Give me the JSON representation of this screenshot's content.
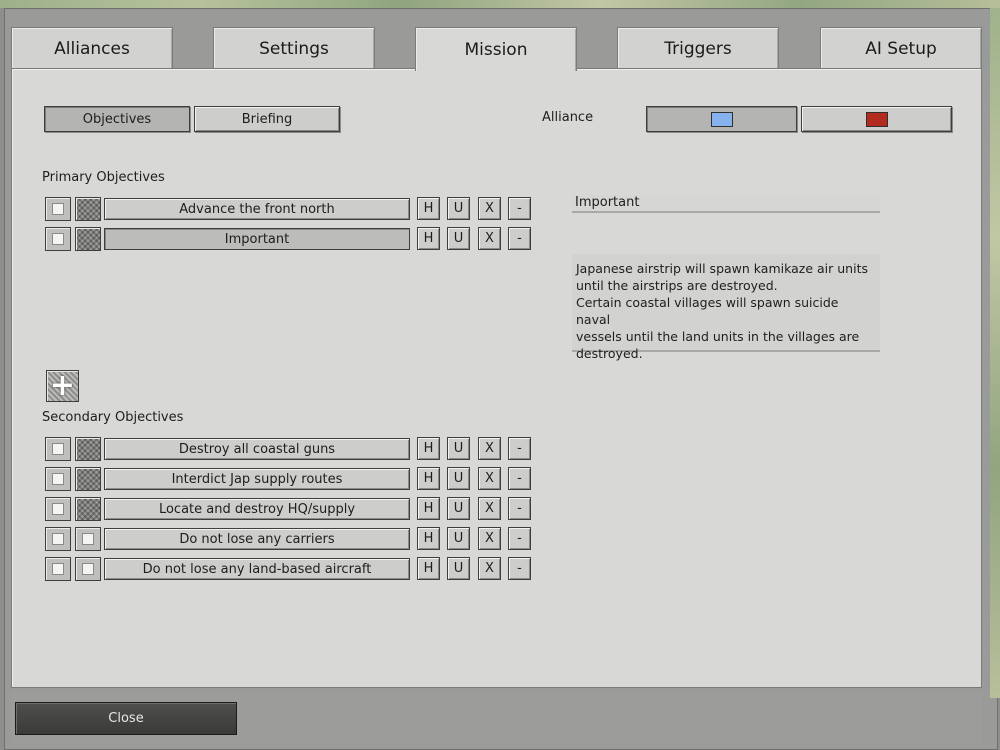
{
  "tabs": [
    {
      "label": "Alliances"
    },
    {
      "label": "Settings"
    },
    {
      "label": "Mission"
    },
    {
      "label": "Triggers"
    },
    {
      "label": "AI Setup"
    }
  ],
  "subtabs": {
    "objectives": "Objectives",
    "briefing": "Briefing"
  },
  "alliance": {
    "label": "Alliance",
    "colors": [
      "#86b2ee",
      "#b32a1e"
    ]
  },
  "primary": {
    "heading": "Primary Objectives",
    "items": [
      {
        "label": "Advance the front north"
      },
      {
        "label": "Important"
      }
    ]
  },
  "secondary": {
    "heading": "Secondary Objectives",
    "items": [
      {
        "label": "Destroy all coastal guns"
      },
      {
        "label": "Interdict Jap supply routes"
      },
      {
        "label": "Locate and destroy HQ/supply"
      },
      {
        "label": "Do not lose any carriers"
      },
      {
        "label": "Do not lose any land-based aircraft"
      }
    ]
  },
  "row_buttons": {
    "h": "H",
    "u": "U",
    "x": "X",
    "minus": "-"
  },
  "detail": {
    "name": "Important",
    "description_lines": [
      "Japanese airstrip will spawn kamikaze air units",
      "until the airstrips are destroyed.",
      "Certain coastal villages will spawn suicide naval",
      "vessels until the land units in the villages are",
      "destroyed."
    ]
  },
  "add_label": "+",
  "close_label": "Close"
}
